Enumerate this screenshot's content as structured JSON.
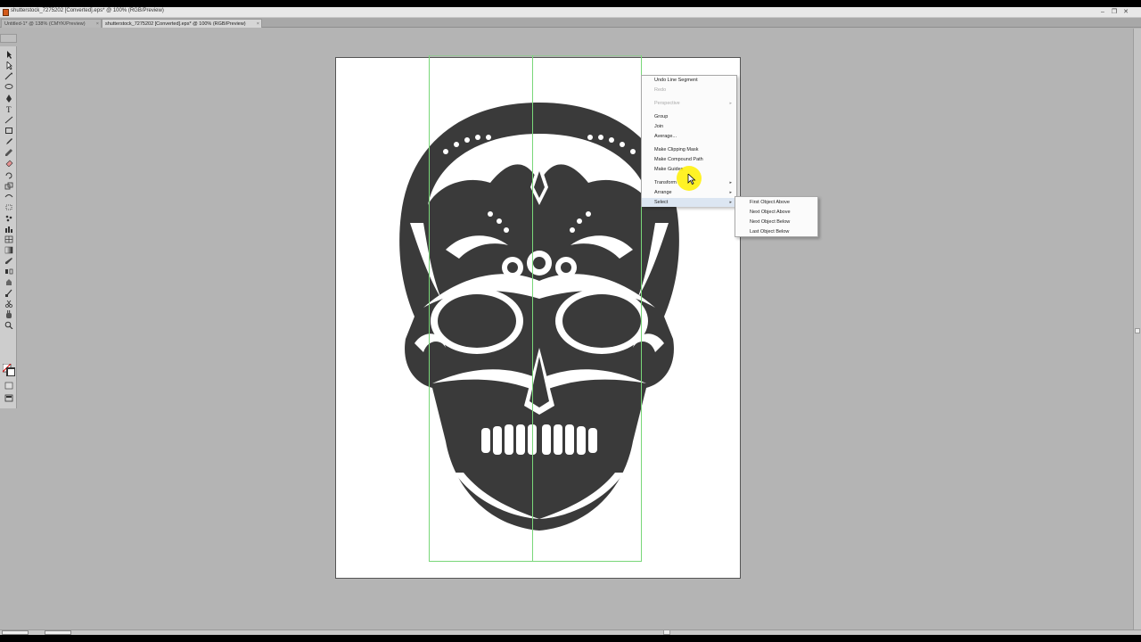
{
  "window": {
    "title": "shutterstock_7275202 [Converted].eps* @ 100% (RGB/Preview)",
    "minimize": "–",
    "restore": "❐",
    "close": "✕"
  },
  "tabs": [
    {
      "label": "Untitled-1* @ 138% (CMYK/Preview)",
      "close": "×"
    },
    {
      "label": "shutterstock_7275202 [Converted].eps* @ 100% (RGB/Preview)",
      "close": "×"
    }
  ],
  "context_menu": {
    "items": [
      {
        "label": "Undo Line Segment",
        "enabled": true
      },
      {
        "label": "Redo",
        "enabled": false
      },
      {
        "label": "Perspective",
        "enabled": false,
        "submenu": true
      },
      {
        "label": "Group",
        "enabled": true
      },
      {
        "label": "Join",
        "enabled": true
      },
      {
        "label": "Average...",
        "enabled": true
      },
      {
        "label": "Make Clipping Mask",
        "enabled": true
      },
      {
        "label": "Make Compound Path",
        "enabled": true
      },
      {
        "label": "Make Guides",
        "enabled": true
      },
      {
        "label": "Transform",
        "enabled": true,
        "submenu": true
      },
      {
        "label": "Arrange",
        "enabled": true,
        "submenu": true
      },
      {
        "label": "Select",
        "enabled": true,
        "submenu": true
      }
    ],
    "submenu_arrow": "▸"
  },
  "select_submenu": {
    "items": [
      {
        "label": "First Object Above"
      },
      {
        "label": "Next Object Above"
      },
      {
        "label": "Next Object Below"
      },
      {
        "label": "Last Object Below"
      }
    ]
  },
  "colors": {
    "artwork": "#3a3a3a",
    "selection": "#79d779",
    "cursor_highlight": "#fff000",
    "canvas": "#b4b4b4"
  },
  "icons": [
    "selection-tool-icon",
    "direct-selection-icon",
    "magic-wand-icon",
    "lasso-icon",
    "pen-icon",
    "type-icon",
    "line-icon",
    "rectangle-icon",
    "paintbrush-icon",
    "pencil-icon",
    "eraser-icon",
    "rotate-icon",
    "scale-icon",
    "warp-icon",
    "free-transform-icon",
    "symbol-sprayer-icon",
    "graph-icon",
    "mesh-icon",
    "gradient-icon",
    "eyedropper-icon",
    "blend-icon",
    "live-paint-icon",
    "slice-icon",
    "scissors-icon",
    "hand-icon",
    "zoom-icon",
    "fill-stroke-icon",
    "draw-mode-icon",
    "screen-mode-icon"
  ]
}
